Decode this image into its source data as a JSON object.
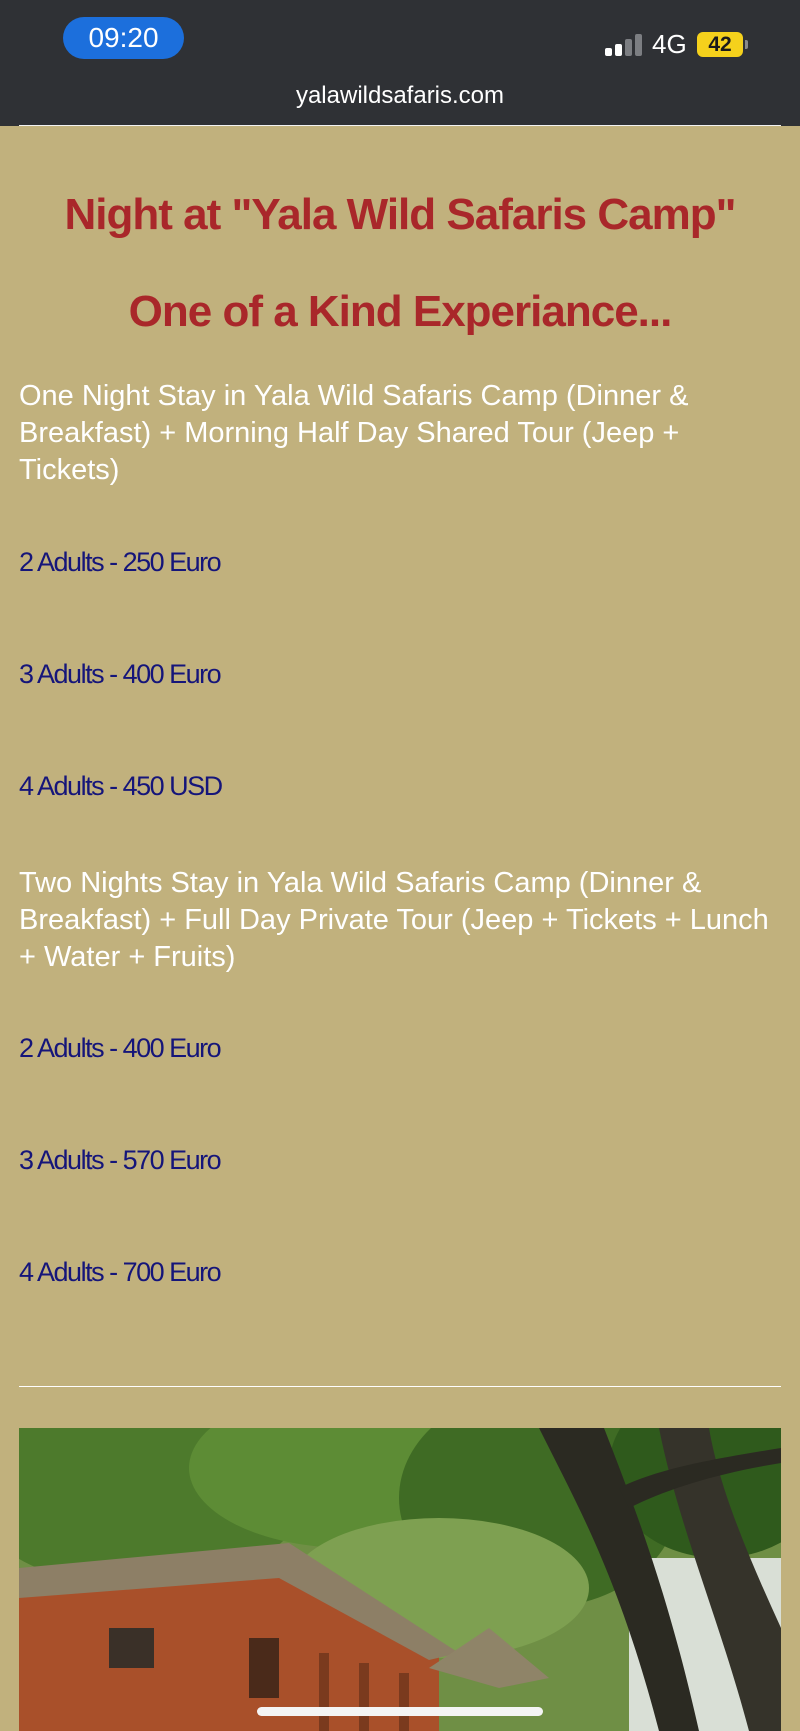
{
  "status_bar": {
    "time": "09:20",
    "network": "4G",
    "battery": "42"
  },
  "browser": {
    "url": "yalawildsafaris.com"
  },
  "heading": "Night at \"Yala Wild Safaris Camp\" One of a Kind Experiance...",
  "packages": [
    {
      "description": "One Night Stay in Yala Wild Safaris Camp (Dinner & Breakfast) + Morning Half Day Shared Tour (Jeep + Tickets)",
      "prices": [
        "2 Adults - 250 Euro",
        "3 Adults - 400 Euro",
        "4 Adults - 450 USD"
      ]
    },
    {
      "description": "Two Nights Stay in Yala Wild Safaris Camp (Dinner & Breakfast) + Full Day Private Tour (Jeep + Tickets + Lunch + Water + Fruits)",
      "prices": [
        "2 Adults - 400 Euro",
        "3 Adults - 570 Euro",
        "4 Adults - 700 Euro"
      ]
    }
  ],
  "colors": {
    "page_background": "#c1b17d",
    "heading": "#a9272a",
    "price_text": "#15157a",
    "status_bar": "#2f3135",
    "time_pill": "#1c6fdc",
    "battery": "#f5d11c"
  }
}
